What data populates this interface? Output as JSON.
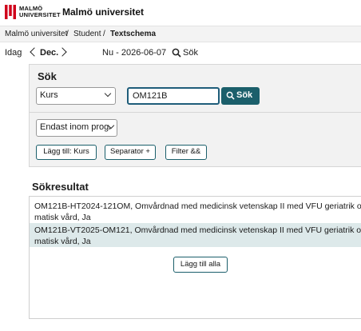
{
  "header": {
    "logo_line1": "MALMÖ",
    "logo_line2": "UNIVERSITET",
    "title": "Malmö universitet"
  },
  "breadcrumb": {
    "items": [
      "Malmö universitet",
      "Student",
      "Textschema"
    ],
    "separator": "/"
  },
  "datenav": {
    "today": "Idag",
    "month": "Dec.",
    "now_label": "Nu - 2026-06-07",
    "search_label": "Sök"
  },
  "search": {
    "title": "Sök",
    "type_select": "Kurs",
    "query_value": "OM121B",
    "search_button": "Sök",
    "filter_select": "Endast inom progr",
    "add_button": "Lägg till: Kurs",
    "separator_button": "Separator +",
    "filter_button": "Filter &&"
  },
  "results": {
    "title": "Sökresultat",
    "rows": [
      {
        "line1": "OM121B-HT2024-121OM, Omvårdnad med medicinsk vetenskap II med VFU geriatrik och so",
        "line2": "matisk vård, Ja"
      },
      {
        "line1": "OM121B-VT2025-OM121, Omvårdnad med medicinsk vetenskap II med VFU geriatrik och so",
        "line2": "matisk vård, Ja"
      }
    ],
    "add_all_button": "Lägg till alla"
  },
  "colors": {
    "accent": "#1b5f6b",
    "logo_red": "#d0021b",
    "row_highlight": "#dde9ea"
  }
}
